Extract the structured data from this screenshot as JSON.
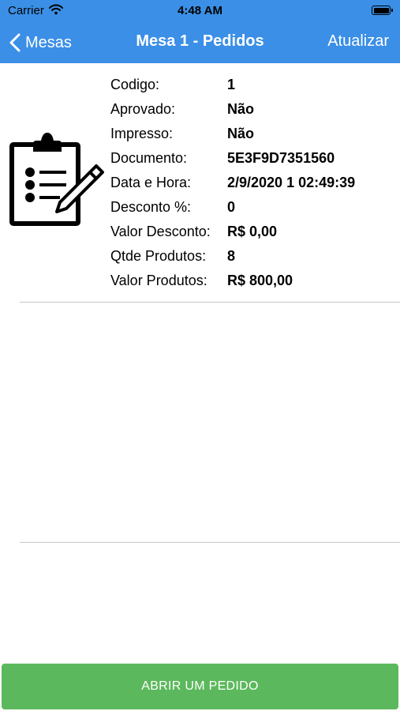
{
  "status_bar": {
    "carrier": "Carrier",
    "time": "4:48 AM",
    "wifi_icon": "wifi-icon",
    "battery_icon": "battery-full-icon"
  },
  "nav": {
    "back_label": "Mesas",
    "title": "Mesa 1 - Pedidos",
    "action_label": "Atualizar",
    "background_color": "#3b8fe6"
  },
  "order": {
    "icon": "clipboard-pencil-icon",
    "fields": [
      {
        "label": "Codigo:",
        "value": "1"
      },
      {
        "label": "Aprovado:",
        "value": "Não"
      },
      {
        "label": "Impresso:",
        "value": "Não"
      },
      {
        "label": "Documento:",
        "value": "5E3F9D7351560"
      },
      {
        "label": "Data e Hora:",
        "value": "2/9/2020 1 02:49:39"
      },
      {
        "label": "Desconto %:",
        "value": "0"
      },
      {
        "label": "Valor Desconto:",
        "value": "R$ 0,00"
      },
      {
        "label": "Qtde Produtos:",
        "value": "8"
      },
      {
        "label": "Valor Produtos:",
        "value": "R$ 800,00"
      }
    ]
  },
  "footer": {
    "button_label": "ABRIR UM PEDIDO",
    "button_color": "#5cb85c"
  }
}
